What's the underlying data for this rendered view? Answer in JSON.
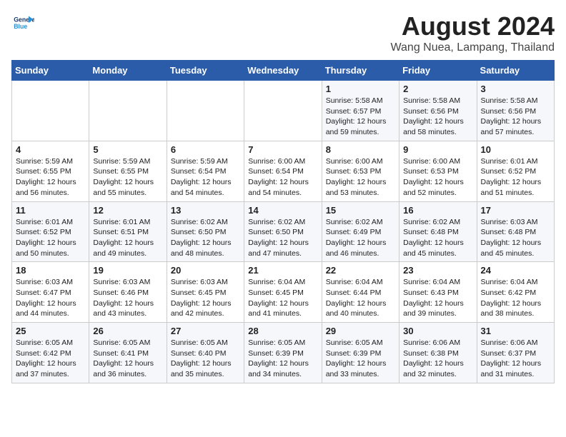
{
  "header": {
    "logo_line1": "General",
    "logo_line2": "Blue",
    "month_year": "August 2024",
    "location": "Wang Nuea, Lampang, Thailand"
  },
  "weekdays": [
    "Sunday",
    "Monday",
    "Tuesday",
    "Wednesday",
    "Thursday",
    "Friday",
    "Saturday"
  ],
  "weeks": [
    [
      {
        "day": "",
        "content": ""
      },
      {
        "day": "",
        "content": ""
      },
      {
        "day": "",
        "content": ""
      },
      {
        "day": "",
        "content": ""
      },
      {
        "day": "1",
        "content": "Sunrise: 5:58 AM\nSunset: 6:57 PM\nDaylight: 12 hours\nand 59 minutes."
      },
      {
        "day": "2",
        "content": "Sunrise: 5:58 AM\nSunset: 6:56 PM\nDaylight: 12 hours\nand 58 minutes."
      },
      {
        "day": "3",
        "content": "Sunrise: 5:58 AM\nSunset: 6:56 PM\nDaylight: 12 hours\nand 57 minutes."
      }
    ],
    [
      {
        "day": "4",
        "content": "Sunrise: 5:59 AM\nSunset: 6:55 PM\nDaylight: 12 hours\nand 56 minutes."
      },
      {
        "day": "5",
        "content": "Sunrise: 5:59 AM\nSunset: 6:55 PM\nDaylight: 12 hours\nand 55 minutes."
      },
      {
        "day": "6",
        "content": "Sunrise: 5:59 AM\nSunset: 6:54 PM\nDaylight: 12 hours\nand 54 minutes."
      },
      {
        "day": "7",
        "content": "Sunrise: 6:00 AM\nSunset: 6:54 PM\nDaylight: 12 hours\nand 54 minutes."
      },
      {
        "day": "8",
        "content": "Sunrise: 6:00 AM\nSunset: 6:53 PM\nDaylight: 12 hours\nand 53 minutes."
      },
      {
        "day": "9",
        "content": "Sunrise: 6:00 AM\nSunset: 6:53 PM\nDaylight: 12 hours\nand 52 minutes."
      },
      {
        "day": "10",
        "content": "Sunrise: 6:01 AM\nSunset: 6:52 PM\nDaylight: 12 hours\nand 51 minutes."
      }
    ],
    [
      {
        "day": "11",
        "content": "Sunrise: 6:01 AM\nSunset: 6:52 PM\nDaylight: 12 hours\nand 50 minutes."
      },
      {
        "day": "12",
        "content": "Sunrise: 6:01 AM\nSunset: 6:51 PM\nDaylight: 12 hours\nand 49 minutes."
      },
      {
        "day": "13",
        "content": "Sunrise: 6:02 AM\nSunset: 6:50 PM\nDaylight: 12 hours\nand 48 minutes."
      },
      {
        "day": "14",
        "content": "Sunrise: 6:02 AM\nSunset: 6:50 PM\nDaylight: 12 hours\nand 47 minutes."
      },
      {
        "day": "15",
        "content": "Sunrise: 6:02 AM\nSunset: 6:49 PM\nDaylight: 12 hours\nand 46 minutes."
      },
      {
        "day": "16",
        "content": "Sunrise: 6:02 AM\nSunset: 6:48 PM\nDaylight: 12 hours\nand 45 minutes."
      },
      {
        "day": "17",
        "content": "Sunrise: 6:03 AM\nSunset: 6:48 PM\nDaylight: 12 hours\nand 45 minutes."
      }
    ],
    [
      {
        "day": "18",
        "content": "Sunrise: 6:03 AM\nSunset: 6:47 PM\nDaylight: 12 hours\nand 44 minutes."
      },
      {
        "day": "19",
        "content": "Sunrise: 6:03 AM\nSunset: 6:46 PM\nDaylight: 12 hours\nand 43 minutes."
      },
      {
        "day": "20",
        "content": "Sunrise: 6:03 AM\nSunset: 6:45 PM\nDaylight: 12 hours\nand 42 minutes."
      },
      {
        "day": "21",
        "content": "Sunrise: 6:04 AM\nSunset: 6:45 PM\nDaylight: 12 hours\nand 41 minutes."
      },
      {
        "day": "22",
        "content": "Sunrise: 6:04 AM\nSunset: 6:44 PM\nDaylight: 12 hours\nand 40 minutes."
      },
      {
        "day": "23",
        "content": "Sunrise: 6:04 AM\nSunset: 6:43 PM\nDaylight: 12 hours\nand 39 minutes."
      },
      {
        "day": "24",
        "content": "Sunrise: 6:04 AM\nSunset: 6:42 PM\nDaylight: 12 hours\nand 38 minutes."
      }
    ],
    [
      {
        "day": "25",
        "content": "Sunrise: 6:05 AM\nSunset: 6:42 PM\nDaylight: 12 hours\nand 37 minutes."
      },
      {
        "day": "26",
        "content": "Sunrise: 6:05 AM\nSunset: 6:41 PM\nDaylight: 12 hours\nand 36 minutes."
      },
      {
        "day": "27",
        "content": "Sunrise: 6:05 AM\nSunset: 6:40 PM\nDaylight: 12 hours\nand 35 minutes."
      },
      {
        "day": "28",
        "content": "Sunrise: 6:05 AM\nSunset: 6:39 PM\nDaylight: 12 hours\nand 34 minutes."
      },
      {
        "day": "29",
        "content": "Sunrise: 6:05 AM\nSunset: 6:39 PM\nDaylight: 12 hours\nand 33 minutes."
      },
      {
        "day": "30",
        "content": "Sunrise: 6:06 AM\nSunset: 6:38 PM\nDaylight: 12 hours\nand 32 minutes."
      },
      {
        "day": "31",
        "content": "Sunrise: 6:06 AM\nSunset: 6:37 PM\nDaylight: 12 hours\nand 31 minutes."
      }
    ]
  ]
}
